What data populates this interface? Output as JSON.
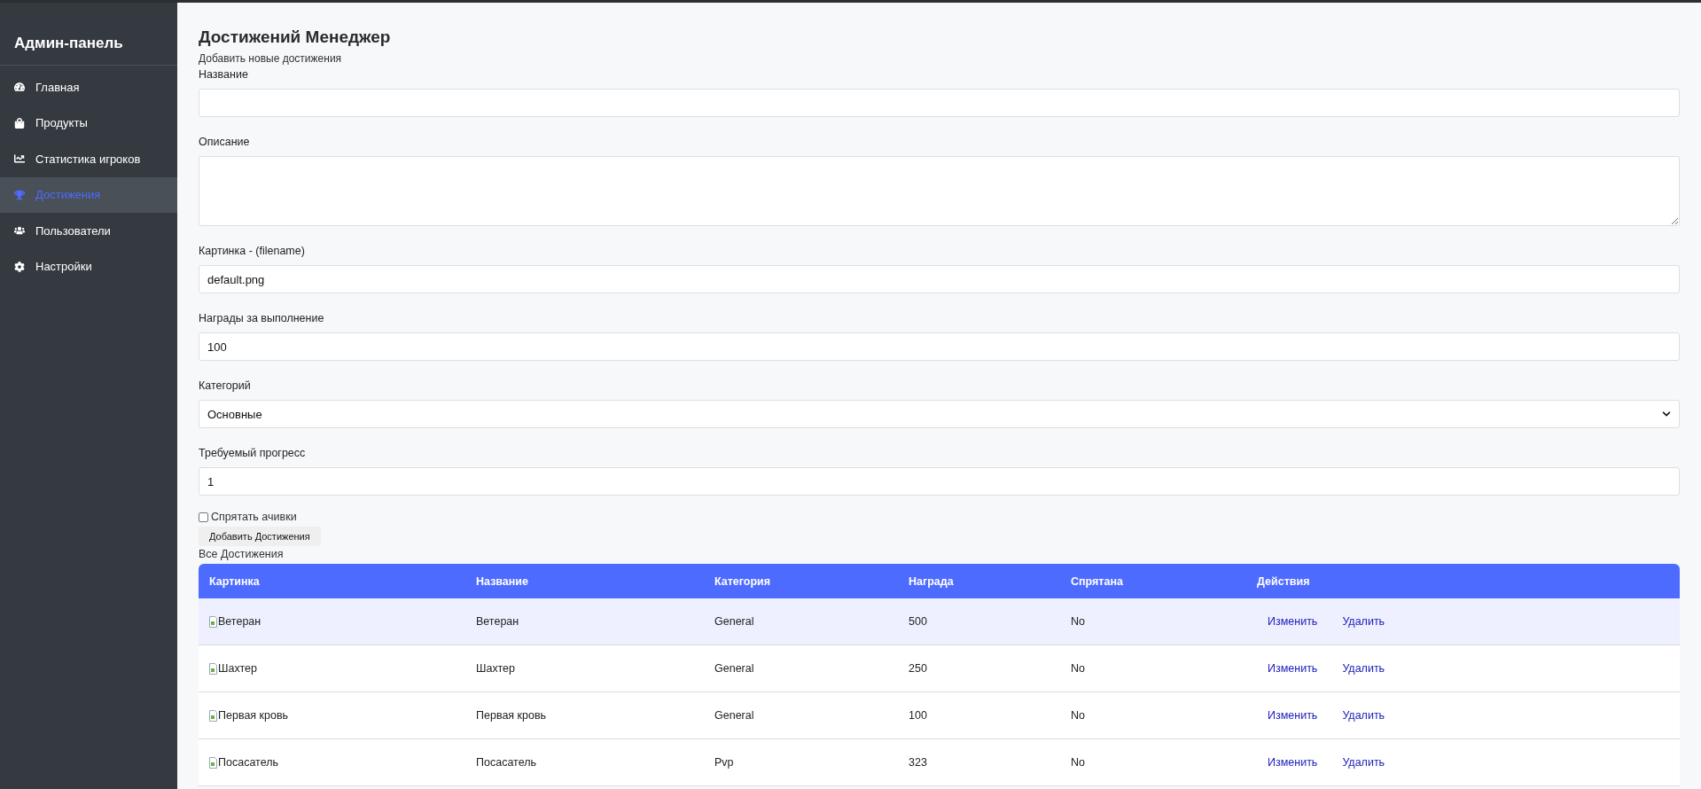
{
  "sidebar": {
    "title": "Админ-панель",
    "items": [
      {
        "label": "Главная",
        "selected": false
      },
      {
        "label": "Продукты",
        "selected": false
      },
      {
        "label": "Статистика игроков",
        "selected": false
      },
      {
        "label": "Достижения",
        "selected": true
      },
      {
        "label": "Пользователи",
        "selected": false
      },
      {
        "label": "Настройки",
        "selected": false
      }
    ]
  },
  "page": {
    "title": "Достижений Менеджер",
    "subtitle": "Добавить новые достижения"
  },
  "form": {
    "fields": [
      {
        "kind": "input",
        "label": "Название"
      },
      {
        "kind": "textarea",
        "label": "Описание"
      },
      {
        "kind": "input",
        "label": "Картинка - (filename)",
        "value": "default.png"
      },
      {
        "kind": "input",
        "label": "Награды за выполнение",
        "value": "100"
      },
      {
        "kind": "select",
        "label": "Категорий",
        "value": "Основные"
      },
      {
        "kind": "input",
        "label": "Требуемый прогресс",
        "value": "1"
      }
    ],
    "hidden_checkbox": {
      "label": "Спрятать ачивки",
      "checked": false
    },
    "submit": "Добавить Достижения"
  },
  "table": {
    "caption": "Все Достижения",
    "columns": [
      "Картинка",
      "Название",
      "Категория",
      "Награда",
      "Спрятана",
      "Действия"
    ],
    "rows": [
      {
        "image_alt": "Ветеран",
        "name": "Ветеран",
        "category": "General",
        "reward": "500",
        "hidden": "No",
        "actions": [
          "Изменить",
          "Удалить"
        ],
        "highlighted": true
      },
      {
        "image_alt": "Шахтер",
        "name": "Шахтер",
        "category": "General",
        "reward": "250",
        "hidden": "No",
        "actions": [
          "Изменить",
          "Удалить"
        ],
        "highlighted": false
      },
      {
        "image_alt": "Первая кровь",
        "name": "Первая кровь",
        "category": "General",
        "reward": "100",
        "hidden": "No",
        "actions": [
          "Изменить",
          "Удалить"
        ],
        "highlighted": false
      },
      {
        "image_alt": "Посасатель",
        "name": "Посасатель",
        "category": "Pvp",
        "reward": "323",
        "hidden": "No",
        "actions": [
          "Изменить",
          "Удалить"
        ],
        "highlighted": false
      }
    ]
  }
}
